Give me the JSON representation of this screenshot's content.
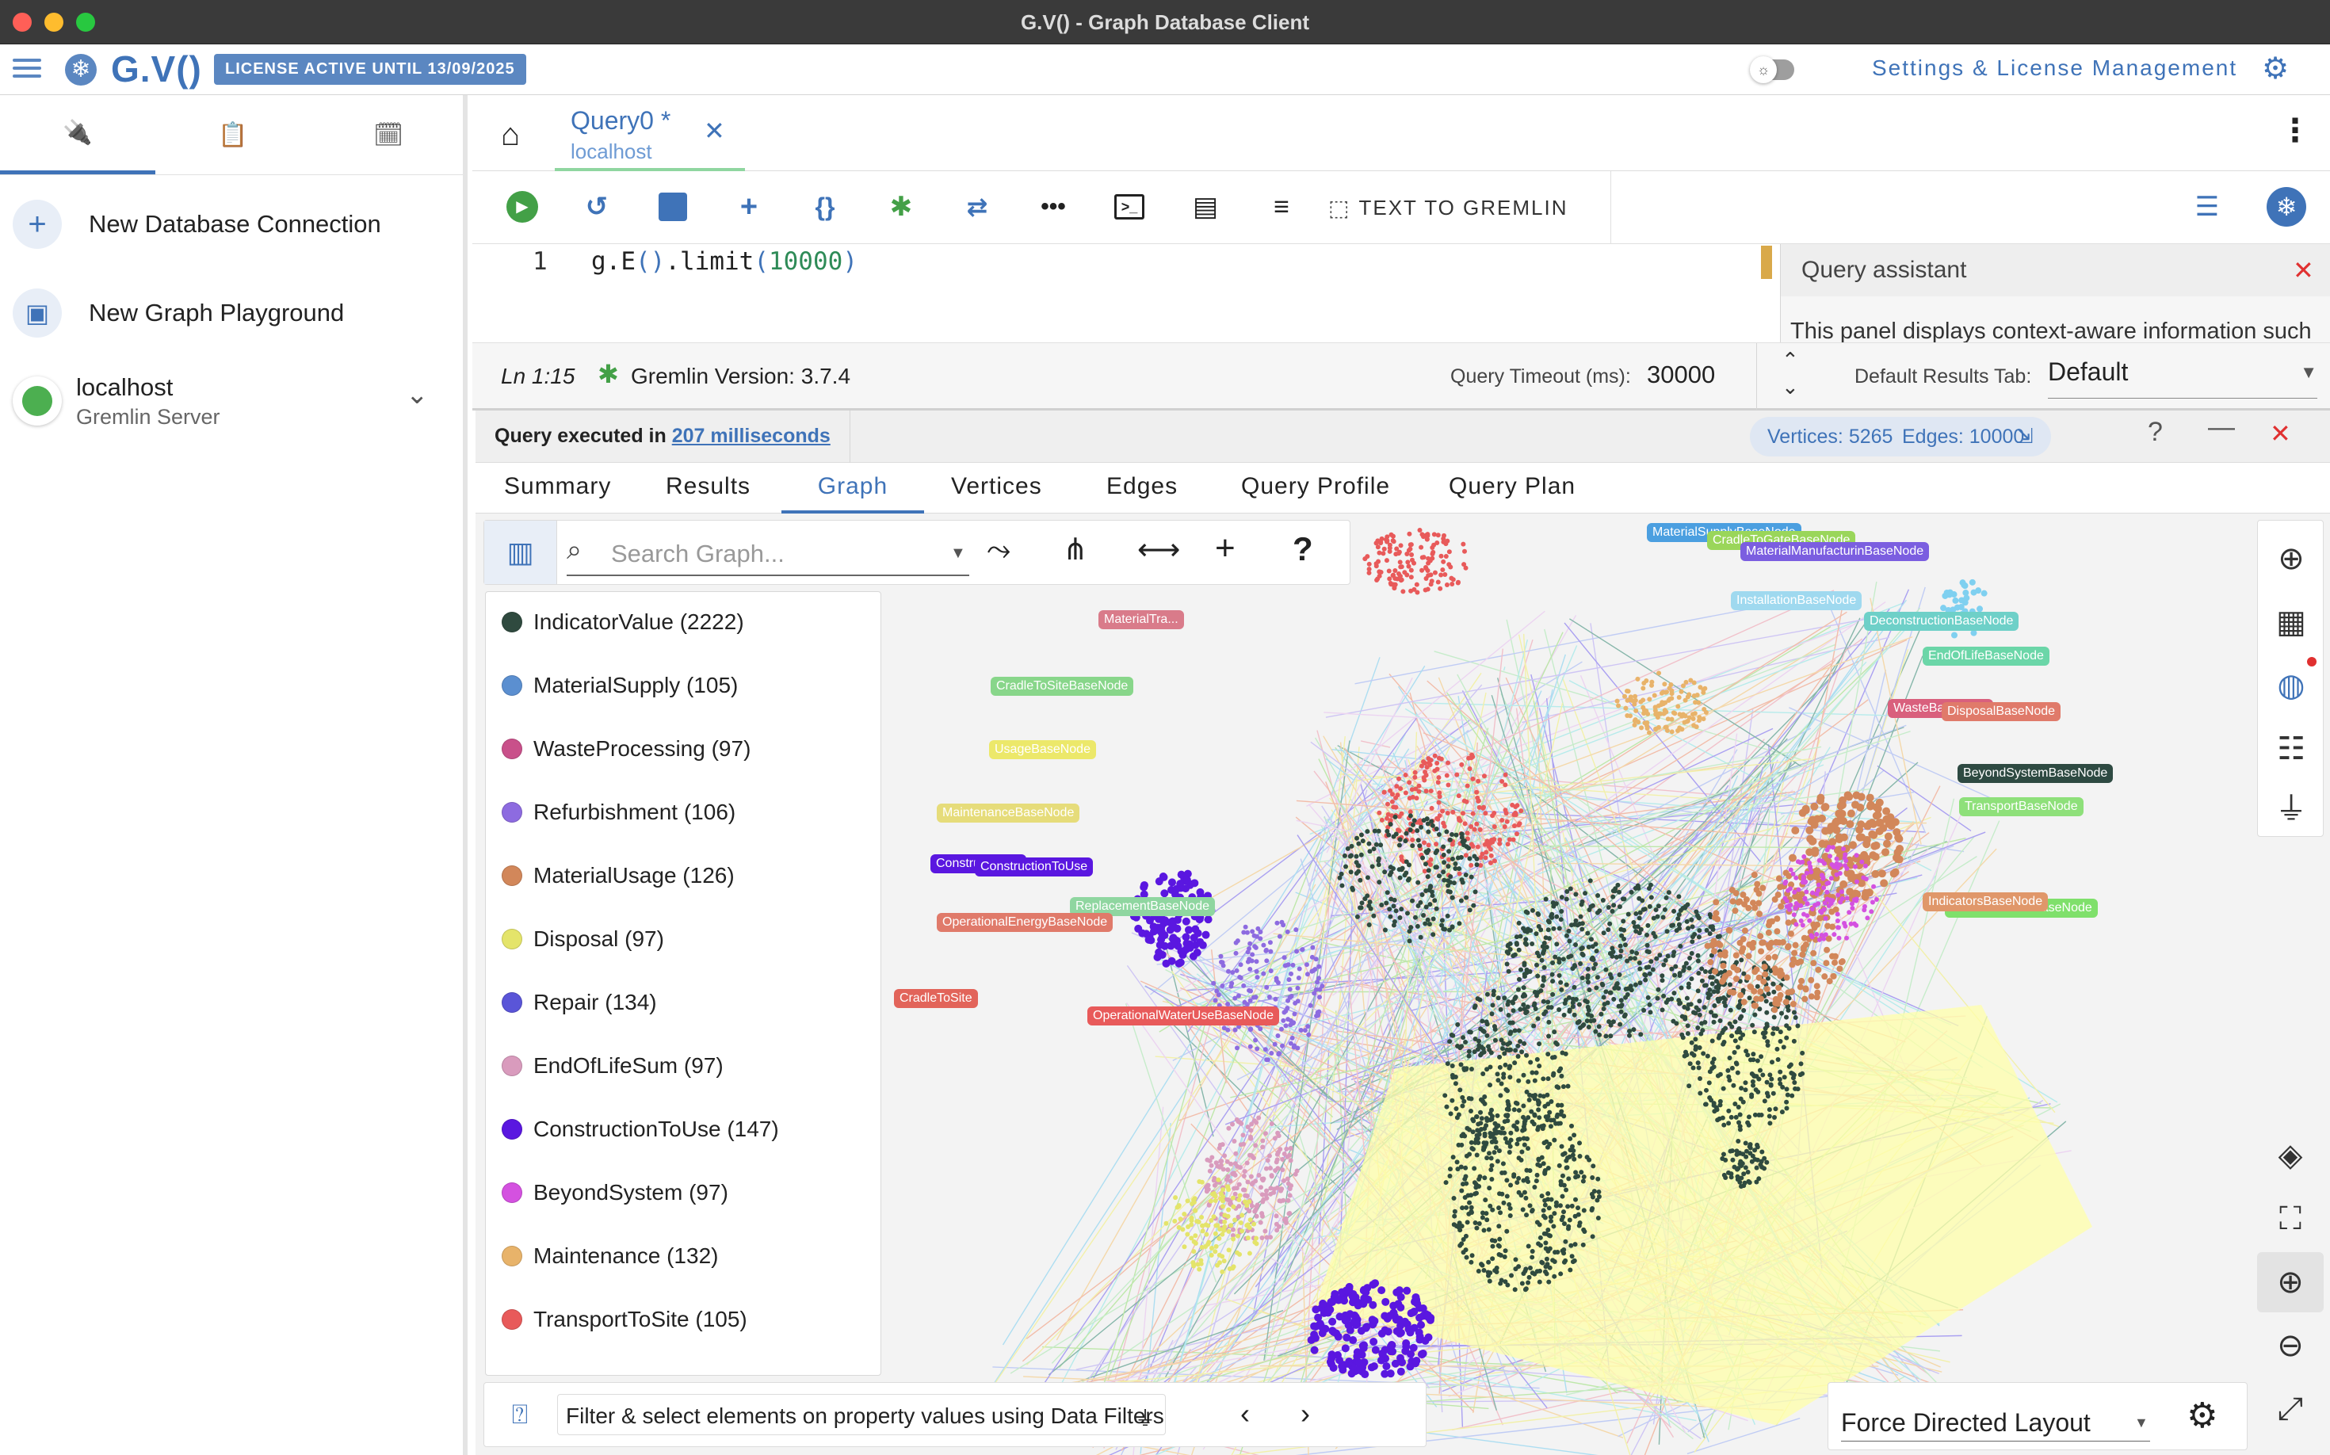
{
  "window": {
    "title": "G.V() - Graph Database Client"
  },
  "app": {
    "logo_text": "G.V()",
    "license_badge": "LICENSE ACTIVE UNTIL 13/09/2025",
    "settings_link": "Settings & License Management"
  },
  "sidebar": {
    "items": [
      {
        "label": "New Database Connection",
        "icon": "plus-icon"
      },
      {
        "label": "New Graph Playground",
        "icon": "chip-icon"
      }
    ],
    "connection": {
      "name": "localhost",
      "type": "Gremlin Server",
      "status_color": "#4caf50"
    }
  },
  "query_tab": {
    "title": "Query0 *",
    "subtitle": "localhost"
  },
  "toolbar": {
    "text_to_gremlin": "TEXT TO GREMLIN"
  },
  "editor": {
    "line_number": "1",
    "code": {
      "a": "g.E",
      "b": "()",
      "c": ".limit",
      "d": "(",
      "e": "10000",
      "f": ")"
    }
  },
  "assistant": {
    "title": "Query assistant",
    "text": "This panel displays context-aware information such"
  },
  "status": {
    "cursor": "Ln 1:15",
    "gremlin_version": "Gremlin Version: 3.7.4",
    "timeout_label": "Query Timeout (ms):",
    "timeout_value": "30000",
    "default_tab_label": "Default Results Tab:",
    "default_tab_value": "Default"
  },
  "result": {
    "executed_prefix": "Query executed in",
    "executed_time": "207 milliseconds",
    "vertices": "Vertices: 5265",
    "edges": "Edges: 10000"
  },
  "result_tabs": [
    "Summary",
    "Results",
    "Graph",
    "Vertices",
    "Edges",
    "Query Profile",
    "Query Plan"
  ],
  "graph": {
    "search_placeholder": "Search Graph...",
    "filter_text": "Filter & select elements on property values using Data Filters",
    "layout": "Force Directed Layout",
    "legend": [
      {
        "label": "IndicatorValue (2222)",
        "color": "#2f4a3f"
      },
      {
        "label": "MaterialSupply (105)",
        "color": "#5b8fd0"
      },
      {
        "label": "WasteProcessing (97)",
        "color": "#c9508a"
      },
      {
        "label": "Refurbishment (106)",
        "color": "#8d6be0"
      },
      {
        "label": "MaterialUsage (126)",
        "color": "#d2875a"
      },
      {
        "label": "Disposal (97)",
        "color": "#e4e46a"
      },
      {
        "label": "Repair (134)",
        "color": "#5a55d8"
      },
      {
        "label": "EndOfLifeSum (97)",
        "color": "#d99bbd"
      },
      {
        "label": "ConstructionToUse (147)",
        "color": "#5a17e0"
      },
      {
        "label": "BeyondSystem (97)",
        "color": "#d451e0"
      },
      {
        "label": "Maintenance (132)",
        "color": "#e8b36a"
      },
      {
        "label": "TransportToSite (105)",
        "color": "#e85a5a"
      }
    ],
    "node_labels": [
      {
        "text": "MaterialSupplyBaseNode",
        "color": "#4b9fe0"
      },
      {
        "text": "CradleToGateBaseNode",
        "color": "#9ad65a"
      },
      {
        "text": "MaterialManufacturinBaseNode",
        "color": "#7b5ee0"
      },
      {
        "text": "CradleToSiteBaseNode",
        "color": "#88d68a"
      },
      {
        "text": "InstallationBaseNode",
        "color": "#9fd9ef"
      },
      {
        "text": "DeconstructionBaseNode",
        "color": "#6ed0c8"
      },
      {
        "text": "EndOfLifeBaseNode",
        "color": "#6bd6a8"
      },
      {
        "text": "WasteBaseNode",
        "color": "#d9607d"
      },
      {
        "text": "DisposalBaseNode",
        "color": "#e07a6a"
      },
      {
        "text": "BeyondSystemBaseNode",
        "color": "#2e4a42"
      },
      {
        "text": "TransportBaseNode",
        "color": "#8ee07a"
      },
      {
        "text": "EndOfLifeSumBaseNode",
        "color": "#7fe06b"
      },
      {
        "text": "IndicatorsBaseNode",
        "color": "#e0976a"
      },
      {
        "text": "MaterialTra...",
        "color": "#d97b8a"
      },
      {
        "text": "UsageBaseNode",
        "color": "#ece86a"
      },
      {
        "text": "MaintenanceBaseNode",
        "color": "#e6dc7a"
      },
      {
        "text": "ConstructionTo",
        "color": "#5a17e0"
      },
      {
        "text": "ConstructionToUse",
        "color": "#5a17e0"
      },
      {
        "text": "ReplacementBaseNode",
        "color": "#8fd6a0"
      },
      {
        "text": "OperationalEnergyBaseNode",
        "color": "#e07a6a"
      },
      {
        "text": "OperationalWaterUseBaseNode",
        "color": "#e85a5a"
      },
      {
        "text": "CradleToSite",
        "color": "#e2645a"
      }
    ]
  }
}
